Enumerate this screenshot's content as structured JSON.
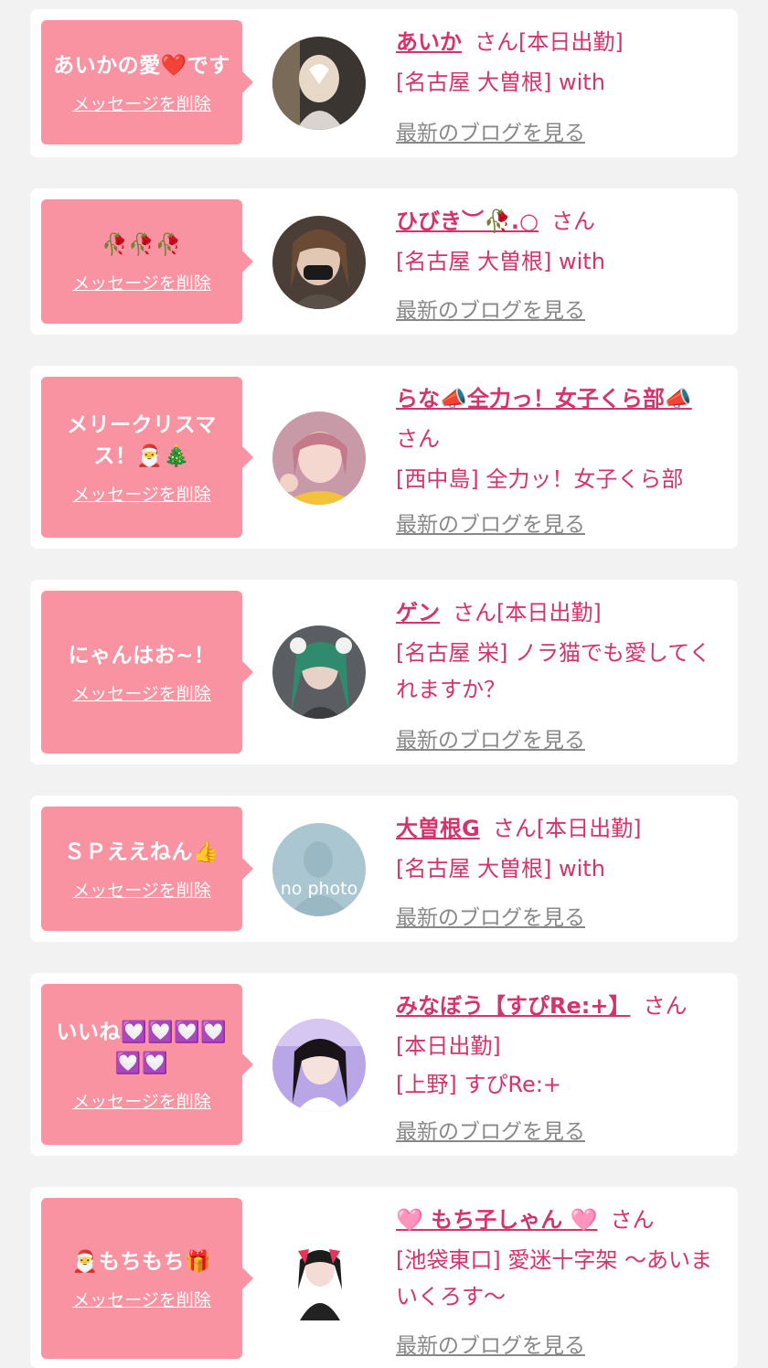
{
  "delete_label": "メッセージを削除",
  "blog_label": "最新のブログを見る",
  "san_suffix": "さん",
  "accent_color": "#d6336c",
  "bubble_color": "#f993a1",
  "cards": [
    {
      "message": "あいかの愛❤️です",
      "name": "あいか",
      "status": "[本日出勤]",
      "shop": "[名古屋 大曽根] with",
      "avatar": "photo"
    },
    {
      "message": "🥀🥀🥀",
      "name": "ひびき︶🥀.○",
      "status": "",
      "shop": "[名古屋 大曽根] with",
      "avatar": "photo"
    },
    {
      "message": "メリークリスマス！🎅🎄",
      "name": "らな📣全力っ！女子くら部📣",
      "status": "",
      "shop": "[西中島] 全力ッ！女子くら部",
      "avatar": "photo"
    },
    {
      "message": "にゃんはお~！",
      "name": "ゲン",
      "status": "[本日出勤]",
      "shop": "[名古屋 栄] ノラ猫でも愛してくれますか？",
      "avatar": "photo"
    },
    {
      "message": "ＳＰええねん👍",
      "name": "大曽根G",
      "status": "[本日出勤]",
      "shop": "[名古屋 大曽根] with",
      "avatar": "no photo"
    },
    {
      "message": "いいね💟💟💟💟💟💟",
      "name": "みなぼう【すぴRe:+】",
      "status": "[本日出勤]",
      "shop": "[上野] すぴRe:+",
      "avatar": "photo"
    },
    {
      "message": "🎅もちもち🎁",
      "name": "🩷 もち子しゃん 🩷",
      "status": "",
      "shop": "[池袋東口] 愛迷十字架 〜あいまいくろす〜",
      "avatar": "photo"
    }
  ]
}
